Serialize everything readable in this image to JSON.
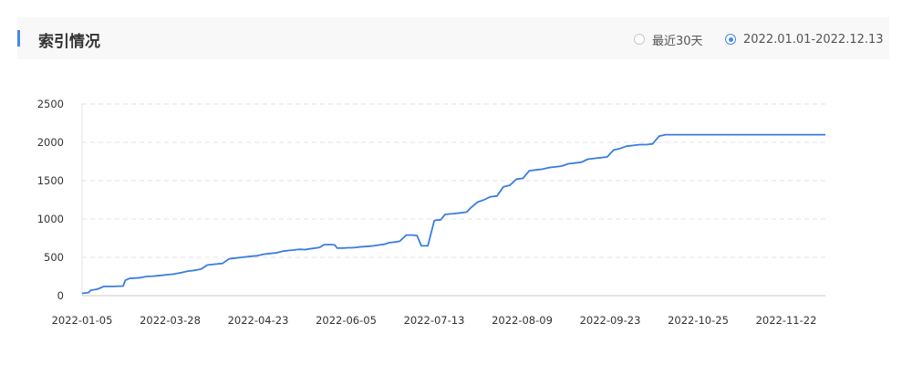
{
  "header": {
    "title": "索引情况",
    "range_options": [
      {
        "label": "最近30天",
        "selected": false
      },
      {
        "label": "2022.01.01-2022.12.13",
        "selected": true
      }
    ]
  },
  "chart_data": {
    "type": "line",
    "title": "",
    "xlabel": "",
    "ylabel": "",
    "ylim": [
      0,
      2500
    ],
    "yticks": [
      0,
      500,
      1000,
      1500,
      2000,
      2500
    ],
    "xticks": [
      "2022-01-05",
      "2022-03-28",
      "2022-04-23",
      "2022-06-05",
      "2022-07-13",
      "2022-08-09",
      "2022-09-23",
      "2022-10-25",
      "2022-11-22"
    ],
    "grid": true,
    "color": "#3a7de0",
    "x": [
      0,
      3,
      4,
      5,
      7,
      8,
      10,
      11,
      14,
      19,
      20,
      22,
      25,
      27,
      29,
      30,
      33,
      35,
      37,
      40,
      42,
      44,
      46,
      49,
      52,
      55,
      58,
      61,
      63,
      65,
      68,
      71,
      74,
      77,
      79,
      81,
      84,
      87,
      90,
      93,
      96,
      98,
      99,
      101,
      103,
      105,
      108,
      110,
      112,
      116,
      117,
      118,
      121,
      123,
      125,
      127,
      128,
      131,
      133,
      135,
      137,
      140,
      142,
      145,
      147,
      150,
      153,
      155,
      157,
      160,
      163,
      164,
      166,
      168,
      170,
      172,
      175,
      178,
      180,
      183,
      185,
      186,
      189,
      192,
      195,
      198,
      201,
      204,
      207,
      210,
      213,
      216,
      219,
      222,
      225,
      228,
      231,
      234,
      237,
      240,
      243,
      246,
      249,
      252,
      255,
      258,
      261,
      264,
      267,
      270,
      273,
      276,
      279,
      282,
      285,
      288,
      291,
      294,
      297,
      300,
      303,
      306,
      309,
      312,
      315,
      318,
      321,
      324,
      327,
      330,
      333,
      335,
      338,
      341,
      344
    ],
    "y": [
      30,
      40,
      70,
      75,
      85,
      95,
      120,
      120,
      120,
      125,
      200,
      225,
      230,
      235,
      245,
      250,
      255,
      260,
      265,
      275,
      280,
      290,
      300,
      320,
      330,
      345,
      400,
      410,
      415,
      420,
      480,
      490,
      500,
      510,
      515,
      520,
      540,
      550,
      560,
      580,
      590,
      595,
      600,
      605,
      600,
      610,
      620,
      630,
      665,
      665,
      660,
      620,
      620,
      625,
      625,
      630,
      635,
      640,
      645,
      650,
      660,
      670,
      690,
      700,
      710,
      790,
      790,
      785,
      650,
      650,
      980,
      985,
      990,
      1060,
      1065,
      1070,
      1080,
      1090,
      1150,
      1220,
      1240,
      1250,
      1290,
      1300,
      1420,
      1440,
      1520,
      1530,
      1630,
      1640,
      1650,
      1670,
      1680,
      1690,
      1720,
      1730,
      1740,
      1780,
      1790,
      1800,
      1810,
      1900,
      1920,
      1950,
      1960,
      1970,
      1970,
      1980,
      2080,
      2100,
      2100,
      2100,
      2100,
      2100,
      2100,
      2100,
      2100,
      2100,
      2100,
      2100,
      2100,
      2100,
      2100,
      2100,
      2100,
      2100,
      2100,
      2100,
      2100,
      2100,
      2100,
      2100,
      2100,
      2100,
      2100
    ]
  }
}
